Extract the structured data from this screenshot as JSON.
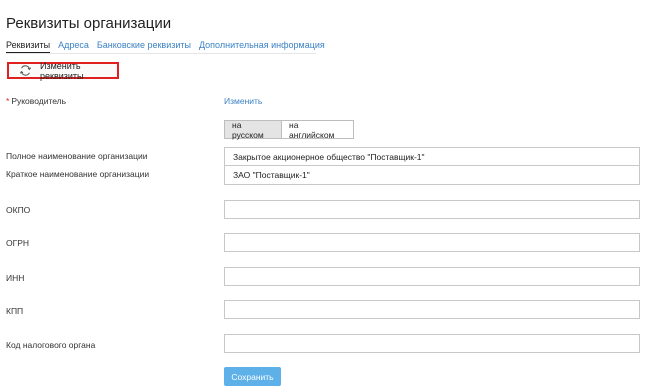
{
  "page": {
    "title": "Реквизиты организации"
  },
  "tabs": [
    {
      "label": "Реквизиты",
      "active": true
    },
    {
      "label": "Адреса"
    },
    {
      "label": "Банковские реквизиты"
    },
    {
      "label": "Дополнительная информация"
    }
  ],
  "toolbar": {
    "edit_label": "Изменить реквизиты",
    "edit_icon": "refresh-icon",
    "highlight_color": "#e02020"
  },
  "director": {
    "label": "Руководитель",
    "required_mark": "*",
    "action": "Изменить"
  },
  "language": {
    "russian": "на русском",
    "english": "на английском",
    "selected": "на русском"
  },
  "fields": {
    "full_name": {
      "label": "Полное наименование организации",
      "value": "Закрытое акционерное общество \"Поставщик-1\""
    },
    "short_name": {
      "label": "Краткое наименование организации",
      "value": "ЗАО \"Поставщик-1\""
    },
    "okpo": {
      "label": "ОКПО",
      "value": ""
    },
    "ogrn": {
      "label": "ОГРН",
      "value": ""
    },
    "inn": {
      "label": "ИНН",
      "value": ""
    },
    "kpp": {
      "label": "КПП",
      "value": ""
    },
    "tax_code": {
      "label": "Код налогового органа",
      "value": ""
    }
  },
  "save_label": "Сохранить",
  "colors": {
    "link": "#3b82c4",
    "primary_button": "#5db0e8"
  }
}
